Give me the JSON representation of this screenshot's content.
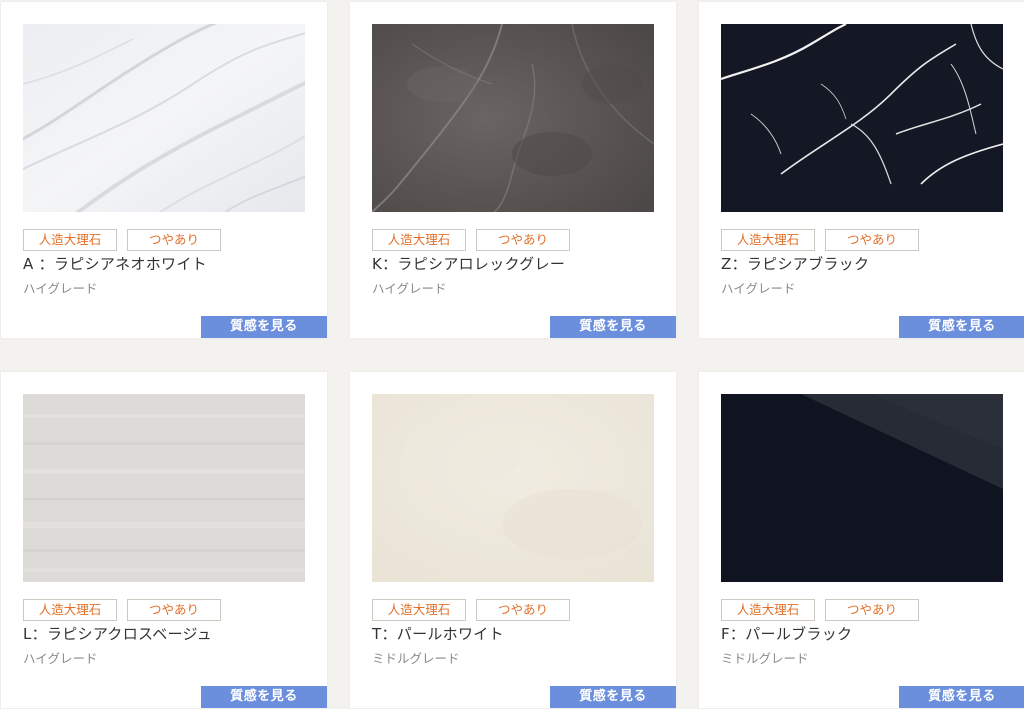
{
  "products": [
    {
      "tag1": "人造大理石",
      "tag2": "つやあり",
      "name": "A ：ラピシアネオホワイト",
      "grade": "ハイグレード",
      "button": "質感を見る",
      "swatch": "white-carrara-marble"
    },
    {
      "tag1": "人造大理石",
      "tag2": "つやあり",
      "name": "K：ラピシアロレックグレー",
      "grade": "ハイグレード",
      "button": "質感を見る",
      "swatch": "grey-marble"
    },
    {
      "tag1": "人造大理石",
      "tag2": "つやあり",
      "name": "Z：ラピシアブラック",
      "grade": "ハイグレード",
      "button": "質感を見る",
      "swatch": "black-marquina-marble"
    },
    {
      "tag1": "人造大理石",
      "tag2": "つやあり",
      "name": "L：ラピシアクロスベージュ",
      "grade": "ハイグレード",
      "button": "質感を見る",
      "swatch": "light-grey-linear-stone"
    },
    {
      "tag1": "人造大理石",
      "tag2": "つやあり",
      "name": "T：パールホワイト",
      "grade": "ミドルグレード",
      "button": "質感を見る",
      "swatch": "cream-solid-surface"
    },
    {
      "tag1": "人造大理石",
      "tag2": "つやあり",
      "name": "F：パールブラック",
      "grade": "ミドルグレード",
      "button": "質感を見る",
      "swatch": "black-solid-surface"
    }
  ],
  "colors": {
    "tag_text": "#e2702a",
    "tag_border": "#cfc9c2",
    "button_bg": "#6b8fdc",
    "page_bg": "#f4f2ee"
  }
}
